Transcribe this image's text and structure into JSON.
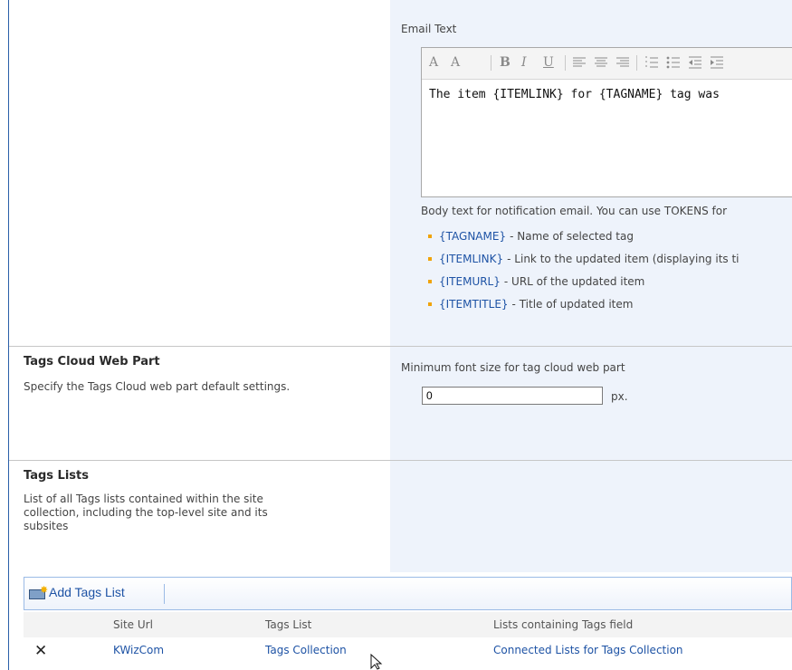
{
  "email_section": {
    "field_label": "Email Text",
    "toolbar": [
      "A",
      "A",
      "B",
      "I",
      "U"
    ],
    "body_text": "The item {ITEMLINK} for {TAGNAME} tag was",
    "help_text": "Body text for notification email. You can use TOKENS for",
    "tokens": [
      {
        "token": "{TAGNAME}",
        "desc": "- Name of selected tag"
      },
      {
        "token": "{ITEMLINK}",
        "desc": "- Link to the updated item (displaying its ti"
      },
      {
        "token": "{ITEMURL}",
        "desc": "- URL of the updated item"
      },
      {
        "token": "{ITEMTITLE}",
        "desc": "- Title of updated item"
      }
    ]
  },
  "tags_cloud_section": {
    "title": "Tags Cloud Web Part",
    "description": "Specify the Tags Cloud web part default settings.",
    "min_font_label": "Minimum font size for tag cloud web part",
    "min_font_value": "0",
    "unit": "px."
  },
  "tags_lists_section": {
    "title": "Tags Lists",
    "description_lines": [
      "List of all Tags lists contained within the site",
      "collection, including the top-level site and its",
      "subsites"
    ]
  },
  "list_toolbar": {
    "add_label": "Add Tags List"
  },
  "grid": {
    "columns": [
      "Site Url",
      "Tags List",
      "Lists containing Tags field"
    ],
    "rows": [
      {
        "site_url": "KWizCom",
        "tags_list": "Tags Collection",
        "connected": "Connected Lists for Tags Collection"
      }
    ]
  }
}
